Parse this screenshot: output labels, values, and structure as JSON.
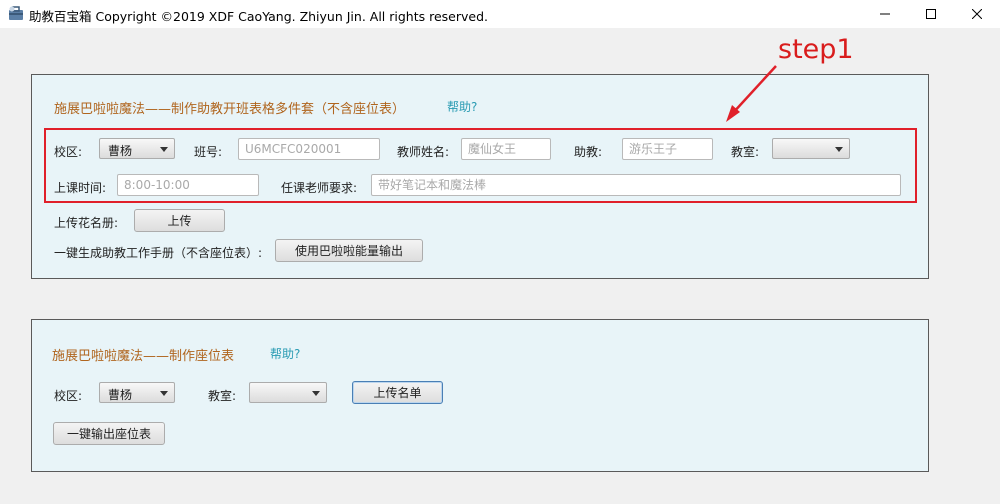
{
  "window": {
    "title": "助教百宝箱 Copyright ©2019 XDF CaoYang. Zhiyun Jin. All rights reserved.",
    "app_icon": "toolbox-icon",
    "controls": [
      "minimize-icon",
      "maximize-icon",
      "close-icon"
    ]
  },
  "annotation": {
    "step_label": "step1",
    "color": "#e0202a"
  },
  "panel1": {
    "heading": "施展巴啦啦魔法——制作助教开班表格多件套（不含座位表）",
    "help": "帮助?",
    "campus_label": "校区:",
    "campus_value": "曹杨",
    "class_no_label": "班号:",
    "class_no_placeholder": "U6MCFC020001",
    "teacher_label": "教师姓名:",
    "teacher_placeholder": "魔仙女王",
    "ta_label": "助教:",
    "ta_placeholder": "游乐王子",
    "room_label": "教室:",
    "room_value": "",
    "time_label": "上课时间:",
    "time_placeholder": "8:00-10:00",
    "requirement_label": "任课老师要求:",
    "requirement_placeholder": "带好笔记本和魔法棒",
    "roster_label": "上传花名册:",
    "upload_button": "上传",
    "generate_label": "一键生成助教工作手册（不含座位表）:",
    "generate_button": "使用巴啦啦能量输出"
  },
  "panel2": {
    "heading": "施展巴啦啦魔法——制作座位表",
    "help": "帮助?",
    "campus_label": "校区:",
    "campus_value": "曹杨",
    "room_label": "教室:",
    "room_value": "",
    "upload_button": "上传名单",
    "export_button": "一键输出座位表"
  },
  "colors": {
    "heading": "#b0651e",
    "help_link": "#2a9bb3",
    "panel_bg": "#e8f4f8"
  }
}
